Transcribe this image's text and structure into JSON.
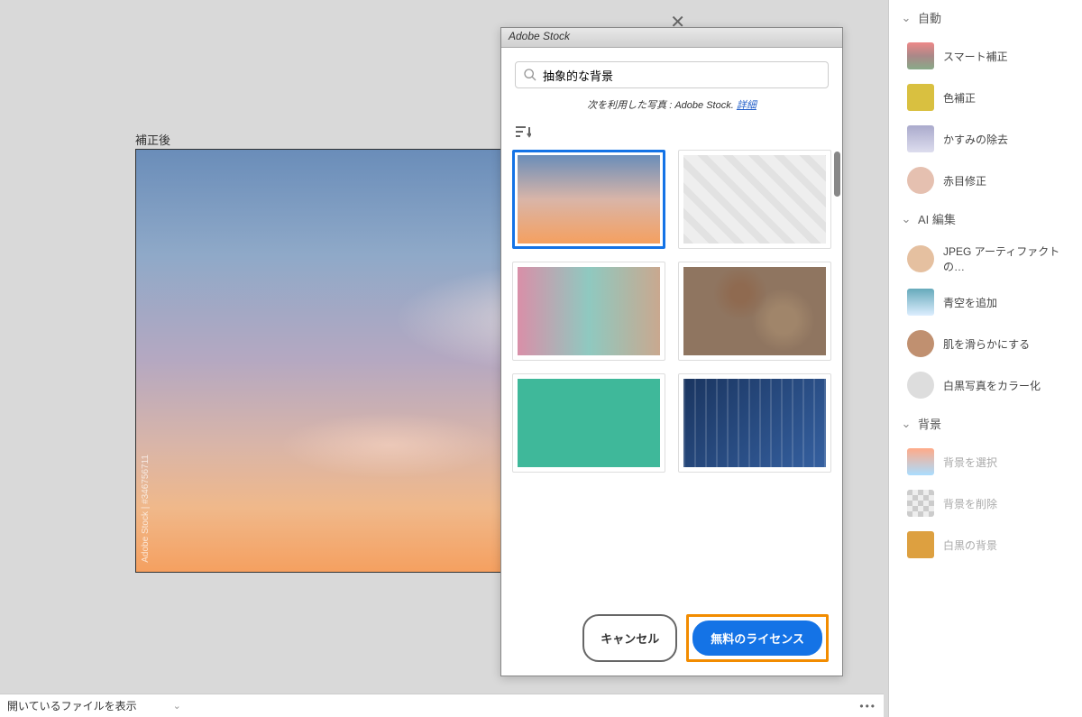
{
  "canvas": {
    "label": "補正後",
    "watermark": "Adobe Stock | #346756711"
  },
  "dialog": {
    "title": "Adobe Stock",
    "search_value": "抽象的な背景",
    "photos_by_prefix": "次を利用した写真 :",
    "photos_by_source": "Adobe Stock.",
    "details_link": "詳細",
    "cancel": "キャンセル",
    "license": "無料のライセンス"
  },
  "sidebar": {
    "sections": {
      "auto": "自動",
      "ai": "AI 編集",
      "bg": "背景"
    },
    "items": {
      "smart": "スマート補正",
      "color": "色補正",
      "haze": "かすみの除去",
      "redeye": "赤目修正",
      "jpeg": "JPEG アーティファクトの…",
      "sky": "青空を追加",
      "skin": "肌を滑らかにする",
      "colorize": "白黒写真をカラー化",
      "bgselect": "背景を選択",
      "bgremove": "背景を削除",
      "bgbw": "白黒の背景"
    }
  },
  "bottom": {
    "show_file": "開いているファイルを表示"
  }
}
